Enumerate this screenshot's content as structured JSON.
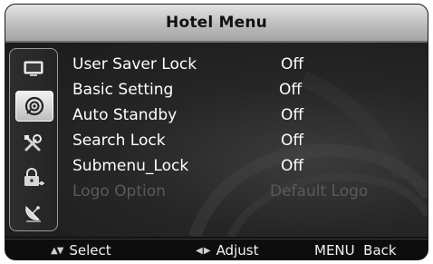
{
  "header": {
    "title": "Hotel Menu"
  },
  "sidebar": {
    "items": [
      {
        "icon": "tv-screen-icon",
        "selected": false
      },
      {
        "icon": "audio-speaker-icon",
        "selected": true
      },
      {
        "icon": "tools-icon",
        "selected": false
      },
      {
        "icon": "lock-key-icon",
        "selected": false
      },
      {
        "icon": "satellite-dish-icon",
        "selected": false
      }
    ]
  },
  "menu": {
    "items": [
      {
        "label": "User Saver Lock",
        "value": "Off",
        "enabled": true
      },
      {
        "label": "Basic Setting",
        "value": "Off",
        "enabled": true
      },
      {
        "label": "Auto Standby",
        "value": "Off",
        "enabled": true
      },
      {
        "label": "Search Lock",
        "value": "Off",
        "enabled": true
      },
      {
        "label": "Submenu_Lock",
        "value": "Off",
        "enabled": true
      },
      {
        "label": "Logo Option",
        "value": "Default Logo",
        "enabled": false
      }
    ]
  },
  "footer": {
    "select_label": "Select",
    "adjust_label": "Adjust",
    "menu_back_label": "MENU  Back"
  },
  "colors": {
    "frame_background": "#111111",
    "title_bar": "#c4c4c4",
    "menu_text": "#ffffff",
    "disabled_text": "#5a5a5a"
  }
}
